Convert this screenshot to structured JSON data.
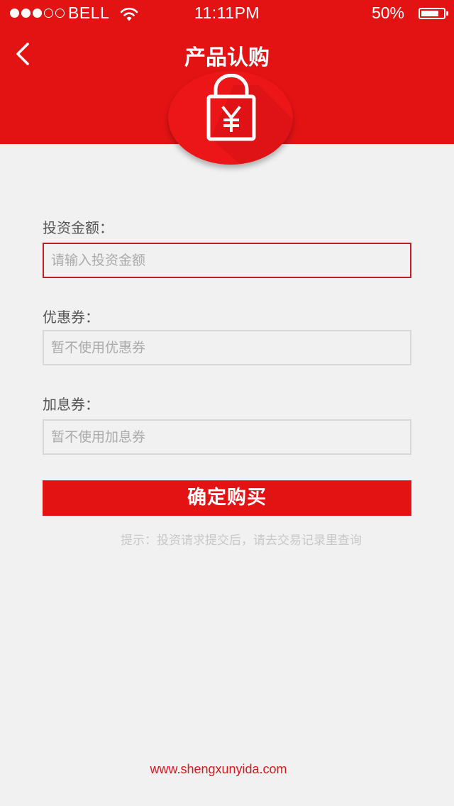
{
  "status_bar": {
    "carrier": "BELL",
    "time": "11:11PM",
    "battery_percent": "50%",
    "battery_level": 0.8,
    "signal_bars_filled": 3,
    "signal_bars_total": 5,
    "icons": [
      "signal-dots-icon",
      "wifi-icon",
      "battery-icon"
    ]
  },
  "header": {
    "title": "产品认购",
    "back_icon": "chevron-left-icon",
    "hero_icon": "lock-yuan-icon",
    "background_color": "#e31314"
  },
  "form": {
    "amount": {
      "label": "投资金额：",
      "placeholder": "请输入投资金额",
      "value": ""
    },
    "coupon": {
      "label": "优惠券：",
      "placeholder": "暂不使用优惠券",
      "value": ""
    },
    "interest_coupon": {
      "label": "加息券：",
      "placeholder": "暂不使用加息券",
      "value": ""
    }
  },
  "buy_button": {
    "label": "确定购买",
    "color": "#e31314"
  },
  "tip": "提示：投资请求提交后，请去交易记录里查询",
  "footer": "www.shengxunyida.com"
}
